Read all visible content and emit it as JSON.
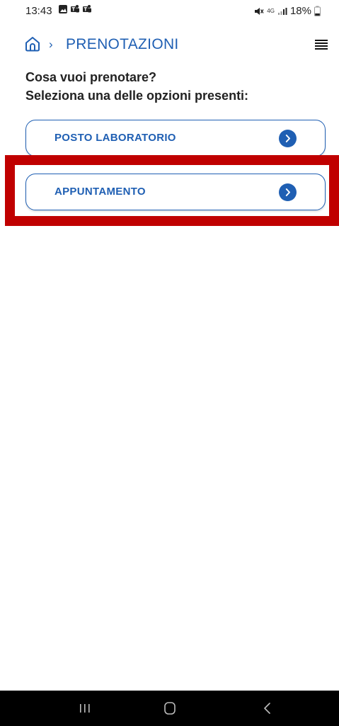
{
  "status_bar": {
    "time": "13:43",
    "notification_icons": [
      "gallery-icon",
      "teams-icon",
      "teams-icon"
    ],
    "network_label": "4G",
    "battery": "18%"
  },
  "header": {
    "breadcrumb_separator": "›",
    "title": "PRENOTAZIONI"
  },
  "prompt": {
    "line1": "Cosa vuoi prenotare?",
    "line2": "Seleziona una delle opzioni presenti:"
  },
  "options": [
    {
      "label": "POSTO LABORATORIO"
    },
    {
      "label": "APPUNTAMENTO",
      "highlighted": true
    }
  ],
  "colors": {
    "accent": "#1f5fb3",
    "highlight": "#c00000",
    "nav_bar": "#000000"
  }
}
